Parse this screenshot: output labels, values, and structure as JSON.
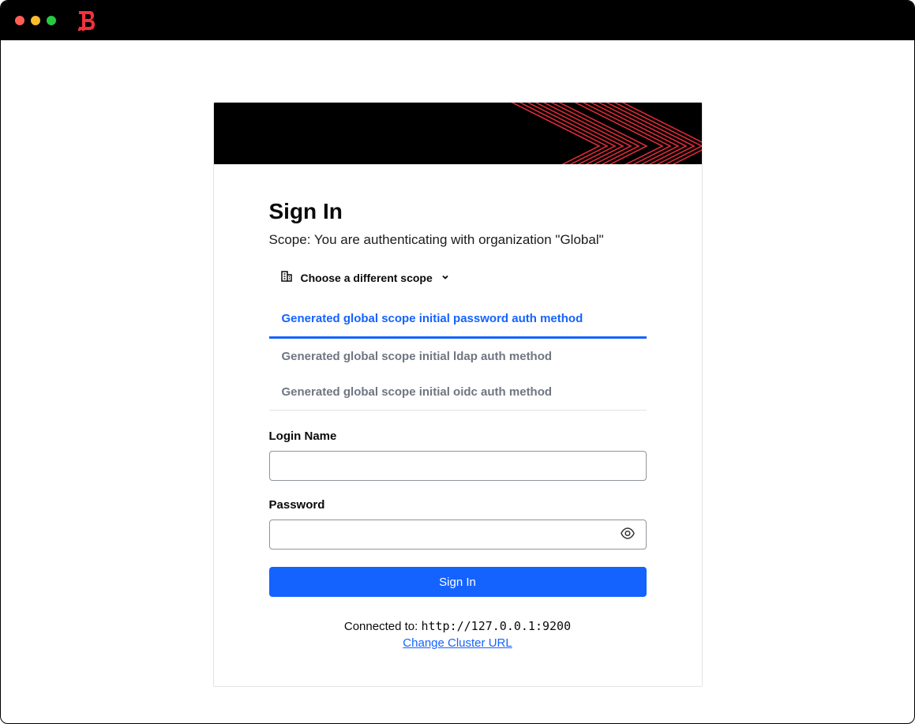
{
  "header": {
    "title": "Sign In",
    "scope_text": "Scope: You are authenticating with organization \"Global\"",
    "choose_scope_label": "Choose a different scope"
  },
  "auth_methods": {
    "items": [
      {
        "label": "Generated global scope initial password auth method",
        "active": true
      },
      {
        "label": "Generated global scope initial ldap auth method",
        "active": false
      },
      {
        "label": "Generated global scope initial oidc auth method",
        "active": false
      }
    ]
  },
  "form": {
    "login_label": "Login Name",
    "login_value": "",
    "password_label": "Password",
    "password_value": "",
    "submit_label": "Sign In"
  },
  "footer": {
    "connected_label": "Connected to: ",
    "cluster_url": "http://127.0.0.1:9200",
    "change_url_label": "Change Cluster URL"
  }
}
